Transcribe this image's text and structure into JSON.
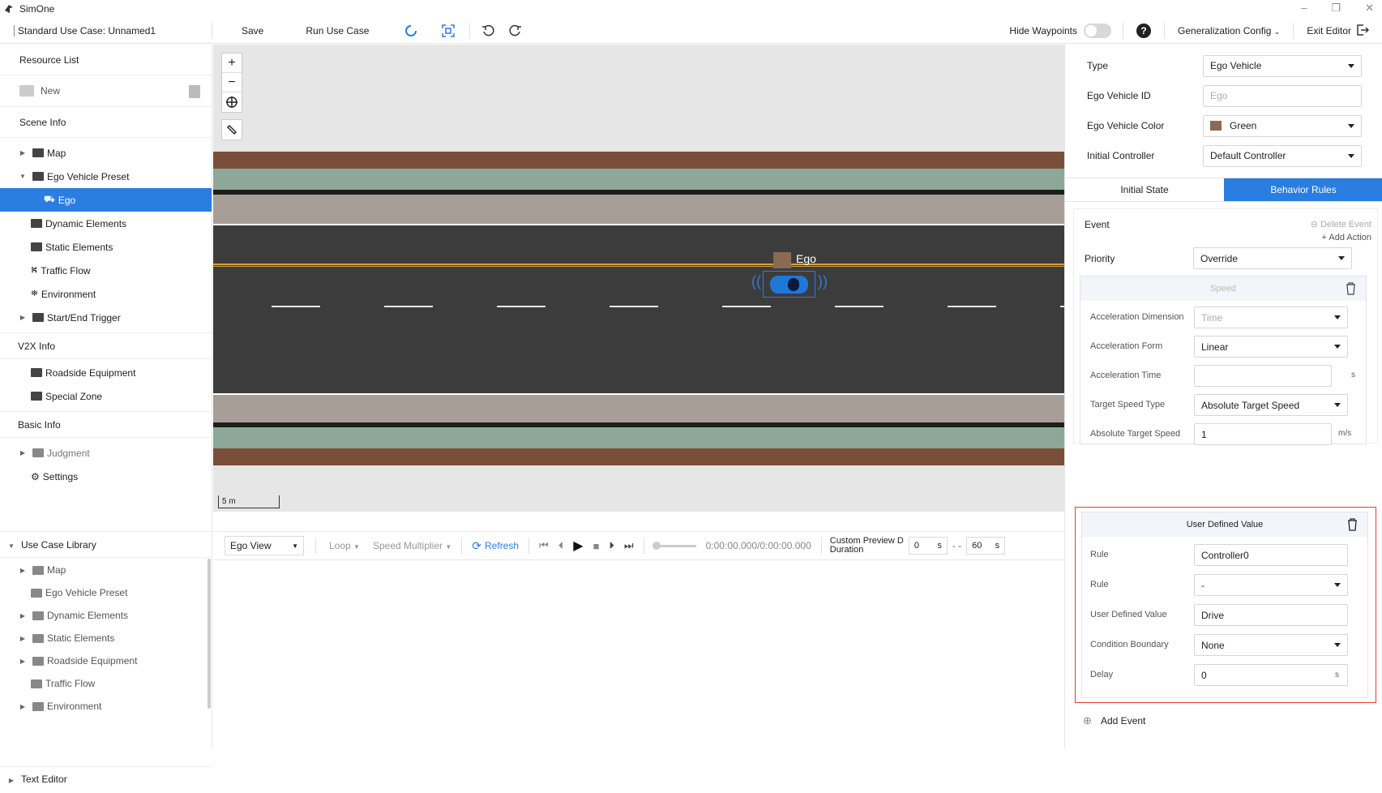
{
  "app": {
    "name": "SimOne"
  },
  "toolbar": {
    "case_name": "Standard Use Case: Unnamed1",
    "save": "Save",
    "run": "Run Use Case",
    "hide_waypoints": "Hide Waypoints",
    "generalization": "Generalization Config",
    "exit": "Exit Editor"
  },
  "resource": {
    "title": "Resource List",
    "new": "New"
  },
  "scene": {
    "title": "Scene Info",
    "items": [
      "Map",
      "Ego Vehicle Preset",
      "Ego",
      "Dynamic Elements",
      "Static Elements",
      "Traffic Flow",
      "Environment",
      "Start/End Trigger"
    ]
  },
  "v2x": {
    "title": "V2X Info",
    "items": [
      "Roadside Equipment",
      "Special Zone"
    ]
  },
  "basic": {
    "title": "Basic Info",
    "items": [
      "Judgment",
      "Settings"
    ]
  },
  "library": {
    "title": "Use Case Library",
    "items": [
      "Map",
      "Ego Vehicle Preset",
      "Dynamic Elements",
      "Static Elements",
      "Roadside Equipment",
      "Traffic Flow",
      "Environment"
    ]
  },
  "text_editor": "Text Editor",
  "canvas": {
    "ego_label": "Ego",
    "scale": "5 m"
  },
  "playbar": {
    "view": "Ego View",
    "loop": "Loop",
    "speed": "Speed Multiplier",
    "refresh": "Refresh",
    "time": "0:00:00.000/0:00:00.000",
    "custom1": "Custom Preview D",
    "custom2": "Duration",
    "start": "0",
    "start_unit": "s",
    "dash": "- -",
    "end": "60",
    "end_unit": "s"
  },
  "props": {
    "type_label": "Type",
    "type_value": "Ego Vehicle",
    "id_label": "Ego Vehicle ID",
    "id_placeholder": "Ego",
    "color_label": "Ego Vehicle Color",
    "color_value": "Green",
    "color_swatch": "#8a6a52",
    "controller_label": "Initial Controller",
    "controller_value": "Default Controller"
  },
  "tabs": {
    "initial": "Initial State",
    "behavior": "Behavior Rules"
  },
  "event": {
    "title": "Event",
    "delete": "Delete Event",
    "add_action": "Add Action",
    "priority_label": "Priority",
    "priority_value": "Override"
  },
  "speed_card": {
    "title": "Speed",
    "acc_dim_label": "Acceleration Dimension",
    "acc_dim_value": "Time",
    "acc_form_label": "Acceleration Form",
    "acc_form_value": "Linear",
    "acc_time_label": "Acceleration Time",
    "acc_time_unit": "s",
    "target_type_label": "Target Speed Type",
    "target_type_value": "Absolute Target Speed",
    "abs_speed_label": "Absolute Target Speed",
    "abs_speed_value": "1",
    "abs_speed_unit": "m/s"
  },
  "udv_card": {
    "title": "User Defined Value",
    "rule1_label": "Rule",
    "rule1_value": "Controller0",
    "rule2_label": "Rule",
    "rule2_value": "-",
    "udv_label": "User Defined Value",
    "udv_value": "Drive",
    "cond_label": "Condition Boundary",
    "cond_value": "None",
    "delay_label": "Delay",
    "delay_value": "0",
    "delay_unit": "s"
  },
  "add_event": "Add Event",
  "colors": {
    "accent": "#2a7de1",
    "highlight_border": "#d9442b"
  }
}
